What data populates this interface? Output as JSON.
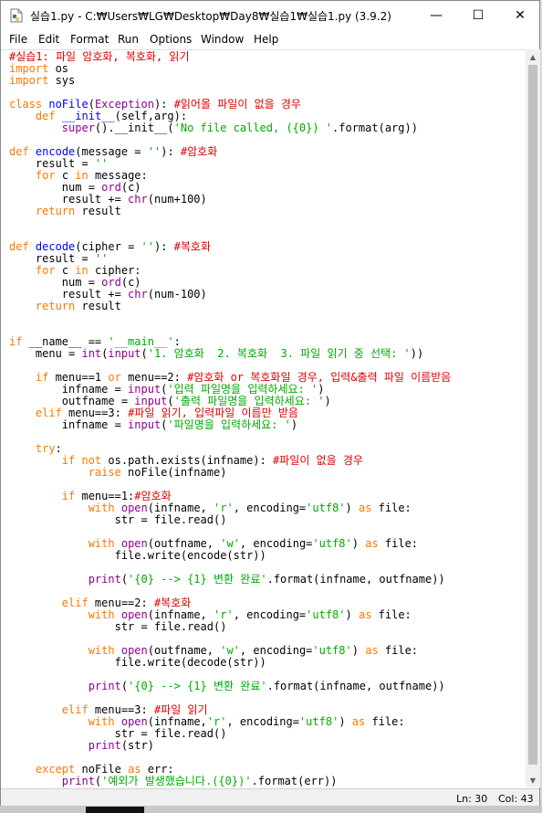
{
  "window": {
    "title": "실습1.py - C:₩Users₩LG₩Desktop₩Day8₩실습1₩실습1.py (3.9.2)",
    "minimize_glyph": "—",
    "maximize_glyph": "☐",
    "close_glyph": "✕"
  },
  "menu": [
    "File",
    "Edit",
    "Format",
    "Run",
    "Options",
    "Window",
    "Help"
  ],
  "status": {
    "line": "Ln: 30",
    "col": "Col: 43"
  },
  "code_lines": [
    [
      [
        "cmt",
        "#실습1: 파일 암호화, 복호화, 읽기"
      ]
    ],
    [
      [
        "kw",
        "import"
      ],
      [
        "",
        " os"
      ]
    ],
    [
      [
        "kw",
        "import"
      ],
      [
        "",
        " sys"
      ]
    ],
    [],
    [
      [
        "kw",
        "class"
      ],
      [
        "",
        " "
      ],
      [
        "def",
        "noFile"
      ],
      [
        "",
        "("
      ],
      [
        "bi",
        "Exception"
      ],
      [
        "",
        "): "
      ],
      [
        "cmt",
        "#읽어올 파일이 없을 경우"
      ]
    ],
    [
      [
        "",
        "    "
      ],
      [
        "kw",
        "def"
      ],
      [
        "",
        " "
      ],
      [
        "def",
        "__init__"
      ],
      [
        "",
        "(self,arg):"
      ]
    ],
    [
      [
        "",
        "        "
      ],
      [
        "bi",
        "super"
      ],
      [
        "",
        "().__init__("
      ],
      [
        "str",
        "'No file called, ({0}) '"
      ],
      [
        "",
        ".format(arg))"
      ]
    ],
    [],
    [
      [
        "kw",
        "def"
      ],
      [
        "",
        " "
      ],
      [
        "def",
        "encode"
      ],
      [
        "",
        "(message = "
      ],
      [
        "str",
        "''"
      ],
      [
        "",
        "): "
      ],
      [
        "cmt",
        "#암호화"
      ]
    ],
    [
      [
        "",
        "    result = "
      ],
      [
        "str",
        "''"
      ]
    ],
    [
      [
        "",
        "    "
      ],
      [
        "kw",
        "for"
      ],
      [
        "",
        " c "
      ],
      [
        "kw",
        "in"
      ],
      [
        "",
        " message:"
      ]
    ],
    [
      [
        "",
        "        num = "
      ],
      [
        "bi",
        "ord"
      ],
      [
        "",
        "(c)"
      ]
    ],
    [
      [
        "",
        "        result += "
      ],
      [
        "bi",
        "chr"
      ],
      [
        "",
        "(num+100)"
      ]
    ],
    [
      [
        "",
        "    "
      ],
      [
        "kw",
        "return"
      ],
      [
        "",
        " result"
      ]
    ],
    [],
    [],
    [
      [
        "kw",
        "def"
      ],
      [
        "",
        " "
      ],
      [
        "def",
        "decode"
      ],
      [
        "",
        "(cipher = "
      ],
      [
        "str",
        "''"
      ],
      [
        "",
        "): "
      ],
      [
        "cmt",
        "#복호화"
      ]
    ],
    [
      [
        "",
        "    result = "
      ],
      [
        "str",
        "''"
      ]
    ],
    [
      [
        "",
        "    "
      ],
      [
        "kw",
        "for"
      ],
      [
        "",
        " c "
      ],
      [
        "kw",
        "in"
      ],
      [
        "",
        " cipher:"
      ]
    ],
    [
      [
        "",
        "        num = "
      ],
      [
        "bi",
        "ord"
      ],
      [
        "",
        "(c)"
      ]
    ],
    [
      [
        "",
        "        result += "
      ],
      [
        "bi",
        "chr"
      ],
      [
        "",
        "(num-100)"
      ]
    ],
    [
      [
        "",
        "    "
      ],
      [
        "kw",
        "return"
      ],
      [
        "",
        " result"
      ]
    ],
    [],
    [],
    [
      [
        "kw",
        "if"
      ],
      [
        "",
        " __name__ == "
      ],
      [
        "str",
        "'__main__'"
      ],
      [
        "",
        ":"
      ]
    ],
    [
      [
        "",
        "    menu = "
      ],
      [
        "bi",
        "int"
      ],
      [
        "",
        "("
      ],
      [
        "bi",
        "input"
      ],
      [
        "",
        "("
      ],
      [
        "str",
        "'1. 암호화  2. 복호화  3. 파일 읽기 중 선택: '"
      ],
      [
        "",
        "))"
      ]
    ],
    [],
    [
      [
        "",
        "    "
      ],
      [
        "kw",
        "if"
      ],
      [
        "",
        " menu==1 "
      ],
      [
        "kw",
        "or"
      ],
      [
        "",
        " menu==2: "
      ],
      [
        "cmt",
        "#암호화 or 복호화일 경우, 입력&출력 파일 이름받음"
      ]
    ],
    [
      [
        "",
        "        infname = "
      ],
      [
        "bi",
        "input"
      ],
      [
        "",
        "("
      ],
      [
        "str",
        "'입력 파일명을 입력하세요: '"
      ],
      [
        "",
        ")"
      ]
    ],
    [
      [
        "",
        "        outfname = "
      ],
      [
        "bi",
        "input"
      ],
      [
        "",
        "("
      ],
      [
        "str",
        "'출력 파일명을 입력하세요: '"
      ],
      [
        "",
        ")"
      ]
    ],
    [
      [
        "",
        "    "
      ],
      [
        "kw",
        "elif"
      ],
      [
        "",
        " menu==3: "
      ],
      [
        "cmt",
        "#파일 읽기, 입력파일 이름만 받음"
      ]
    ],
    [
      [
        "",
        "        infname = "
      ],
      [
        "bi",
        "input"
      ],
      [
        "",
        "("
      ],
      [
        "str",
        "'파일명을 입력하세요: '"
      ],
      [
        "",
        ")"
      ]
    ],
    [],
    [
      [
        "",
        "    "
      ],
      [
        "kw",
        "try"
      ],
      [
        "",
        ":"
      ]
    ],
    [
      [
        "",
        "        "
      ],
      [
        "kw",
        "if"
      ],
      [
        "",
        " "
      ],
      [
        "kw",
        "not"
      ],
      [
        "",
        " os.path.exists(infname): "
      ],
      [
        "cmt",
        "#파일이 없을 경우"
      ]
    ],
    [
      [
        "",
        "            "
      ],
      [
        "kw",
        "raise"
      ],
      [
        "",
        " noFile(infname)"
      ]
    ],
    [],
    [
      [
        "",
        "        "
      ],
      [
        "kw",
        "if"
      ],
      [
        "",
        " menu==1:"
      ],
      [
        "cmt",
        "#암호화"
      ]
    ],
    [
      [
        "",
        "            "
      ],
      [
        "kw",
        "with"
      ],
      [
        "",
        " "
      ],
      [
        "bi",
        "open"
      ],
      [
        "",
        "(infname, "
      ],
      [
        "str",
        "'r'"
      ],
      [
        "",
        ", encoding="
      ],
      [
        "str",
        "'utf8'"
      ],
      [
        "",
        ") "
      ],
      [
        "kw",
        "as"
      ],
      [
        "",
        " file:"
      ]
    ],
    [
      [
        "",
        "                str = file.read()"
      ]
    ],
    [],
    [
      [
        "",
        "            "
      ],
      [
        "kw",
        "with"
      ],
      [
        "",
        " "
      ],
      [
        "bi",
        "open"
      ],
      [
        "",
        "(outfname, "
      ],
      [
        "str",
        "'w'"
      ],
      [
        "",
        ", encoding="
      ],
      [
        "str",
        "'utf8'"
      ],
      [
        "",
        ") "
      ],
      [
        "kw",
        "as"
      ],
      [
        "",
        " file:"
      ]
    ],
    [
      [
        "",
        "                file.write(encode(str))"
      ]
    ],
    [],
    [
      [
        "",
        "            "
      ],
      [
        "bi",
        "print"
      ],
      [
        "",
        "("
      ],
      [
        "str",
        "'{0} --> {1} 변환 완료'"
      ],
      [
        "",
        ".format(infname, outfname))"
      ]
    ],
    [],
    [
      [
        "",
        "        "
      ],
      [
        "kw",
        "elif"
      ],
      [
        "",
        " menu==2: "
      ],
      [
        "cmt",
        "#복호화"
      ]
    ],
    [
      [
        "",
        "            "
      ],
      [
        "kw",
        "with"
      ],
      [
        "",
        " "
      ],
      [
        "bi",
        "open"
      ],
      [
        "",
        "(infname, "
      ],
      [
        "str",
        "'r'"
      ],
      [
        "",
        ", encoding="
      ],
      [
        "str",
        "'utf8'"
      ],
      [
        "",
        ") "
      ],
      [
        "kw",
        "as"
      ],
      [
        "",
        " file:"
      ]
    ],
    [
      [
        "",
        "                str = file.read()"
      ]
    ],
    [],
    [
      [
        "",
        "            "
      ],
      [
        "kw",
        "with"
      ],
      [
        "",
        " "
      ],
      [
        "bi",
        "open"
      ],
      [
        "",
        "(outfname, "
      ],
      [
        "str",
        "'w'"
      ],
      [
        "",
        ", encoding="
      ],
      [
        "str",
        "'utf8'"
      ],
      [
        "",
        ") "
      ],
      [
        "kw",
        "as"
      ],
      [
        "",
        " file:"
      ]
    ],
    [
      [
        "",
        "                file.write(decode(str))"
      ]
    ],
    [],
    [
      [
        "",
        "            "
      ],
      [
        "bi",
        "print"
      ],
      [
        "",
        "("
      ],
      [
        "str",
        "'{0} --> {1} 변환 완료'"
      ],
      [
        "",
        ".format(infname, outfname))"
      ]
    ],
    [],
    [
      [
        "",
        "        "
      ],
      [
        "kw",
        "elif"
      ],
      [
        "",
        " menu==3: "
      ],
      [
        "cmt",
        "#파일 읽기"
      ]
    ],
    [
      [
        "",
        "            "
      ],
      [
        "kw",
        "with"
      ],
      [
        "",
        " "
      ],
      [
        "bi",
        "open"
      ],
      [
        "",
        "(infname,"
      ],
      [
        "str",
        "'r'"
      ],
      [
        "",
        ", encoding="
      ],
      [
        "str",
        "'utf8'"
      ],
      [
        "",
        ") "
      ],
      [
        "kw",
        "as"
      ],
      [
        "",
        " file:"
      ]
    ],
    [
      [
        "",
        "                str = file.read()"
      ]
    ],
    [
      [
        "",
        "            "
      ],
      [
        "bi",
        "print"
      ],
      [
        "",
        "(str)"
      ]
    ],
    [],
    [
      [
        "",
        "    "
      ],
      [
        "kw",
        "except"
      ],
      [
        "",
        " noFile "
      ],
      [
        "kw",
        "as"
      ],
      [
        "",
        " err:"
      ]
    ],
    [
      [
        "",
        "        "
      ],
      [
        "bi",
        "print"
      ],
      [
        "",
        "("
      ],
      [
        "str",
        "'예외가 발생했습니다.({0})'"
      ],
      [
        "",
        ".format(err))"
      ]
    ]
  ]
}
